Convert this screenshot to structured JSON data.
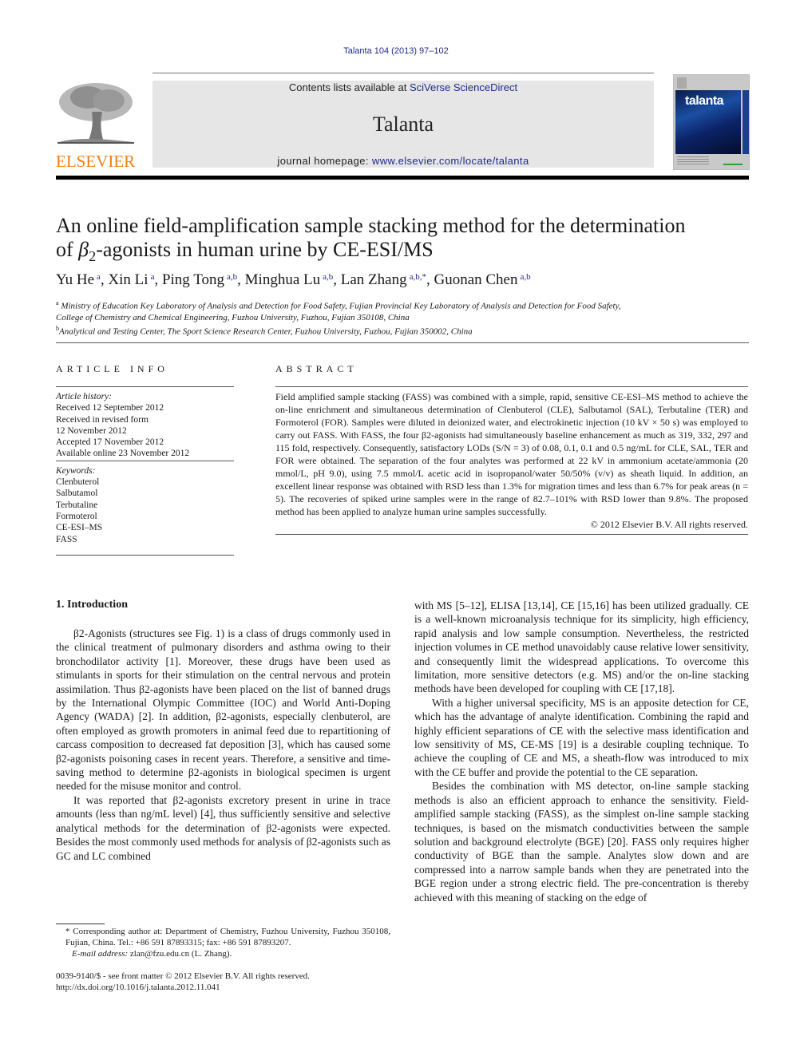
{
  "journal_ref": "Talanta 104 (2013) 97–102",
  "masthead": {
    "contents_prefix": "Contents lists available at ",
    "contents_link": "SciVerse ScienceDirect",
    "journal_title": "Talanta",
    "homepage_prefix": "journal homepage: ",
    "homepage_link": "www.elsevier.com/locate/talanta",
    "publisher_logo_text": "ELSEVIER",
    "cover_title": "talanta"
  },
  "colors": {
    "link": "#1f2a8c",
    "elsevier_orange": "#f07f12",
    "masthead_bg": "#e6e6e6"
  },
  "article": {
    "title_line1": "An online field-amplification sample stacking method for the determination",
    "title_line2_pre": "of ",
    "title_beta": "β",
    "title_sub": "2",
    "title_line2_post": "-agonists in human urine by CE-ESI/MS",
    "authors": [
      {
        "name": "Yu He",
        "aff": "a",
        "sep": ", "
      },
      {
        "name": "Xin Li",
        "aff": "a",
        "sep": ", "
      },
      {
        "name": "Ping Tong",
        "aff": "a,b",
        "sep": ", "
      },
      {
        "name": "Minghua Lu",
        "aff": "a,b",
        "sep": ", "
      },
      {
        "name": "Lan Zhang",
        "aff": "a,b,*",
        "sep": ", "
      },
      {
        "name": "Guonan Chen",
        "aff": "a,b",
        "sep": ""
      }
    ],
    "affiliations": [
      {
        "mark": "a",
        "line1": "Ministry of Education Key Laboratory of Analysis and Detection for Food Safety, Fujian Provincial Key Laboratory of Analysis and Detection for Food Safety,",
        "line2": "College of Chemistry and Chemical Engineering, Fuzhou University, Fuzhou, Fujian 350108, China"
      },
      {
        "mark": "b",
        "line1": "Analytical and Testing Center, The Sport Science Research Center, Fuzhou University, Fuzhou, Fujian 350002, China",
        "line2": ""
      }
    ]
  },
  "article_info": {
    "heading": "ARTICLE INFO",
    "history_label": "Article history:",
    "history": [
      "Received 12 September 2012",
      "Received in revised form",
      "12 November 2012",
      "Accepted 17 November 2012",
      "Available online 23 November 2012"
    ],
    "keywords_label": "Keywords:",
    "keywords": [
      "Clenbuterol",
      "Salbutamol",
      "Terbutaline",
      "Formoterol",
      "CE-ESI–MS",
      "FASS"
    ]
  },
  "abstract": {
    "heading": "ABSTRACT",
    "text": "Field amplified sample stacking (FASS) was combined with a simple, rapid, sensitive CE-ESI–MS method to achieve the on-line enrichment and simultaneous determination of Clenbuterol (CLE), Salbutamol (SAL), Terbutaline (TER) and Formoterol (FOR). Samples were diluted in deionized water, and electrokinetic injection (10 kV × 50 s) was employed to carry out FASS. With FASS, the four β2-agonists had simultaneously baseline enhancement as much as 319, 332, 297 and 115 fold, respectively. Consequently, satisfactory LODs (S/N = 3) of 0.08, 0.1, 0.1 and 0.5 ng/mL for CLE, SAL, TER and FOR were obtained. The separation of the four analytes was performed at 22 kV in ammonium acetate/ammonia (20 mmol/L, pH 9.0), using 7.5 mmol/L acetic acid in isopropanol/water 50/50% (v/v) as sheath liquid. In addition, an excellent linear response was obtained with RSD less than 1.3% for migration times and less than 6.7% for peak areas (n = 5). The recoveries of spiked urine samples were in the range of 82.7–101% with RSD lower than 9.8%. The proposed method has been applied to analyze human urine samples successfully.",
    "copyright": "© 2012 Elsevier B.V. All rights reserved."
  },
  "intro": {
    "heading": "1.   Introduction",
    "left_paragraphs": [
      "β2-Agonists (structures see Fig. 1) is a class of drugs commonly used in the clinical treatment of pulmonary disorders and asthma owing to their bronchodilator activity [1]. Moreover, these drugs have been used as stimulants in sports for their stimulation on the central nervous and protein assimilation. Thus β2-agonists have been placed on the list of banned drugs by the International Olympic Committee (IOC) and World Anti-Doping Agency (WADA) [2]. In addition, β2-agonists, especially clenbuterol, are often employed as growth promoters in animal feed due to repartitioning of carcass composition to decreased fat deposition [3], which has caused some β2-agonists poisoning cases in recent years. Therefore, a sensitive and time-saving method to determine β2-agonists in biological specimen is urgent needed for the misuse monitor and control.",
      "It was reported that β2-agonists excretory present in urine in trace amounts (less than ng/mL level) [4], thus sufficiently sensitive and selective analytical methods for the determination of β2-agonists were expected. Besides the most commonly used methods for analysis of β2-agonists such as GC and LC combined"
    ],
    "right_paragraphs": [
      "with MS [5–12], ELISA [13,14], CE [15,16] has been utilized gradually. CE is a well-known microanalysis technique for its simplicity, high efficiency, rapid analysis and low sample consumption. Nevertheless, the restricted injection volumes in CE method unavoidably cause relative lower sensitivity, and consequently limit the widespread applications. To overcome this limitation, more sensitive detectors (e.g. MS) and/or the on-line stacking methods have been developed for coupling with CE [17,18].",
      "With a higher universal specificity, MS is an apposite detection for CE, which has the advantage of analyte identification. Combining the rapid and highly efficient separations of CE with the selective mass identification and low sensitivity of MS, CE-MS [19] is a desirable coupling technique. To achieve the coupling of CE and MS, a sheath-flow was introduced to mix with the CE buffer and provide the potential to the CE separation.",
      "Besides the combination with MS detector, on-line sample stacking methods is also an efficient approach to enhance the sensitivity. Field-amplified sample stacking (FASS), as the simplest on-line sample stacking techniques, is based on the mismatch conductivities between the sample solution and background electrolyte (BGE) [20]. FASS only requires higher conductivity of BGE than the sample. Analytes slow down and are compressed into a narrow sample bands when they are penetrated into the BGE region under a strong electric field. The pre-concentration is thereby achieved with this meaning of stacking on the edge of"
    ]
  },
  "footnote": {
    "corresponding": "* Corresponding author at: Department of Chemistry, Fuzhou University, Fuzhou 350108, Fujian, China. Tel.: +86 591 87893315; fax: +86 591 87893207.",
    "email_label": "E-mail address:",
    "email": "zlan@fzu.edu.cn (L. Zhang)."
  },
  "frontmatter": {
    "issn_line": "0039-9140/$ - see front matter © 2012 Elsevier B.V. All rights reserved.",
    "doi": "http://dx.doi.org/10.1016/j.talanta.2012.11.041"
  }
}
